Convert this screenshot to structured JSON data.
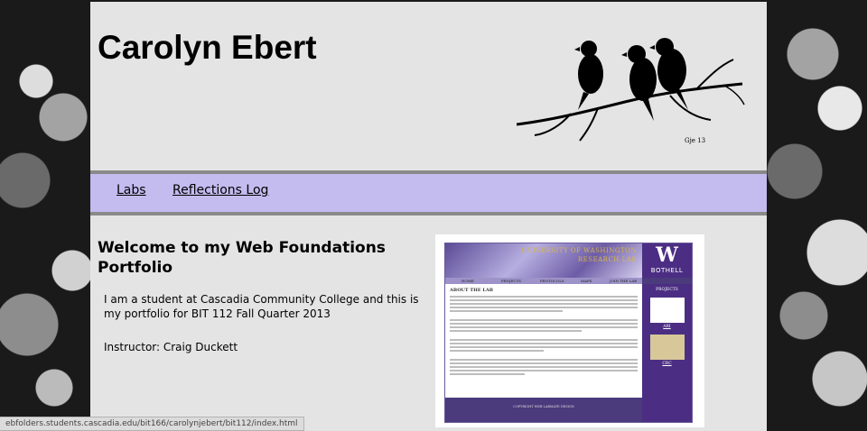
{
  "header": {
    "title": "Carolyn Ebert",
    "art_signature": "Gje 13"
  },
  "nav": {
    "items": [
      {
        "label": "Labs"
      },
      {
        "label": "Reflections Log"
      }
    ]
  },
  "main": {
    "heading": "Welcome to my Web Foundations Portfolio",
    "intro": "I am a student at Cascadia Community College and this is my portfolio for BIT 112 Fall Quarter 2013",
    "instructor": "Instructor: Craig Duckett"
  },
  "screenshot": {
    "banner_line1": "UNIVERSITY OF WASHINGTON",
    "banner_line2": "RESEARCH LAB",
    "logo_letter": "W",
    "logo_text": "BOTHELL",
    "nav_items": [
      "HOME",
      "PROJECTS",
      "PROTOCOLS",
      "MAPS",
      "JOIN THE LAB"
    ],
    "about": "ABOUT THE LAB",
    "side_heading": "PROJECTS",
    "side_items": [
      "ARI",
      "CRC"
    ],
    "footer": "COPYRIGHT WEB LABMATE DESIGN"
  },
  "status_bar": {
    "url": "ebfolders.students.cascadia.edu/bit166/carolynjebert/bit112/index.html"
  }
}
